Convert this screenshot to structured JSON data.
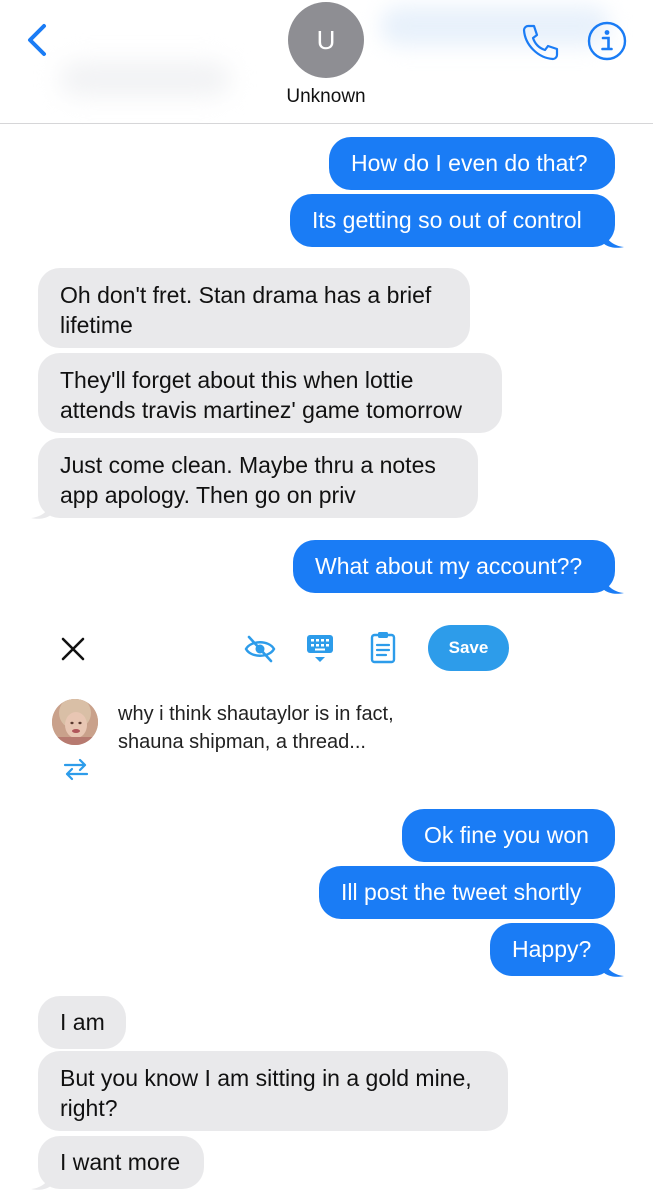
{
  "header": {
    "back_icon": "chevron-left-icon",
    "avatar_initial": "U",
    "contact_name": "Unknown",
    "phone_icon": "phone-icon",
    "info_icon": "info-icon",
    "accent_color": "#1a7cf5"
  },
  "messages": [
    {
      "direction": "outgoing",
      "text": "How do I even do that?"
    },
    {
      "direction": "outgoing",
      "text": "Its getting so out of control"
    },
    {
      "direction": "incoming",
      "lines": [
        "Oh don't fret. Stan drama has a brief",
        "lifetime"
      ]
    },
    {
      "direction": "incoming",
      "lines": [
        "They'll forget about this when lottie",
        "attends travis martinez' game tomorrow"
      ]
    },
    {
      "direction": "incoming",
      "lines": [
        "Just come clean. Maybe thru a notes",
        "app apology. Then go on priv"
      ]
    },
    {
      "direction": "outgoing",
      "text": "What about my account??"
    },
    {
      "direction": "outgoing",
      "text": "Ok fine you won"
    },
    {
      "direction": "outgoing",
      "text": "Ill post the tweet shortly"
    },
    {
      "direction": "outgoing",
      "text": "Happy?"
    },
    {
      "direction": "incoming",
      "text": "I am"
    },
    {
      "direction": "incoming",
      "lines": [
        "But you know I am sitting in a gold mine,",
        "right?"
      ]
    },
    {
      "direction": "incoming",
      "text": "I want more"
    }
  ],
  "draft_toolbar": {
    "close_icon": "close-icon",
    "hide_icon": "eye-off-icon",
    "keyboard_icon": "keyboard-icon",
    "clipboard_icon": "clipboard-icon",
    "save_label": "Save",
    "save_color": "#2d9cea"
  },
  "tweet": {
    "text": "why i think shautaylor is in fact,\nshauna shipman, a thread...",
    "retweet_icon": "retweet-icon"
  },
  "colors": {
    "outgoing_bubble": "#1a7cf5",
    "incoming_bubble": "#e9e9eb"
  }
}
